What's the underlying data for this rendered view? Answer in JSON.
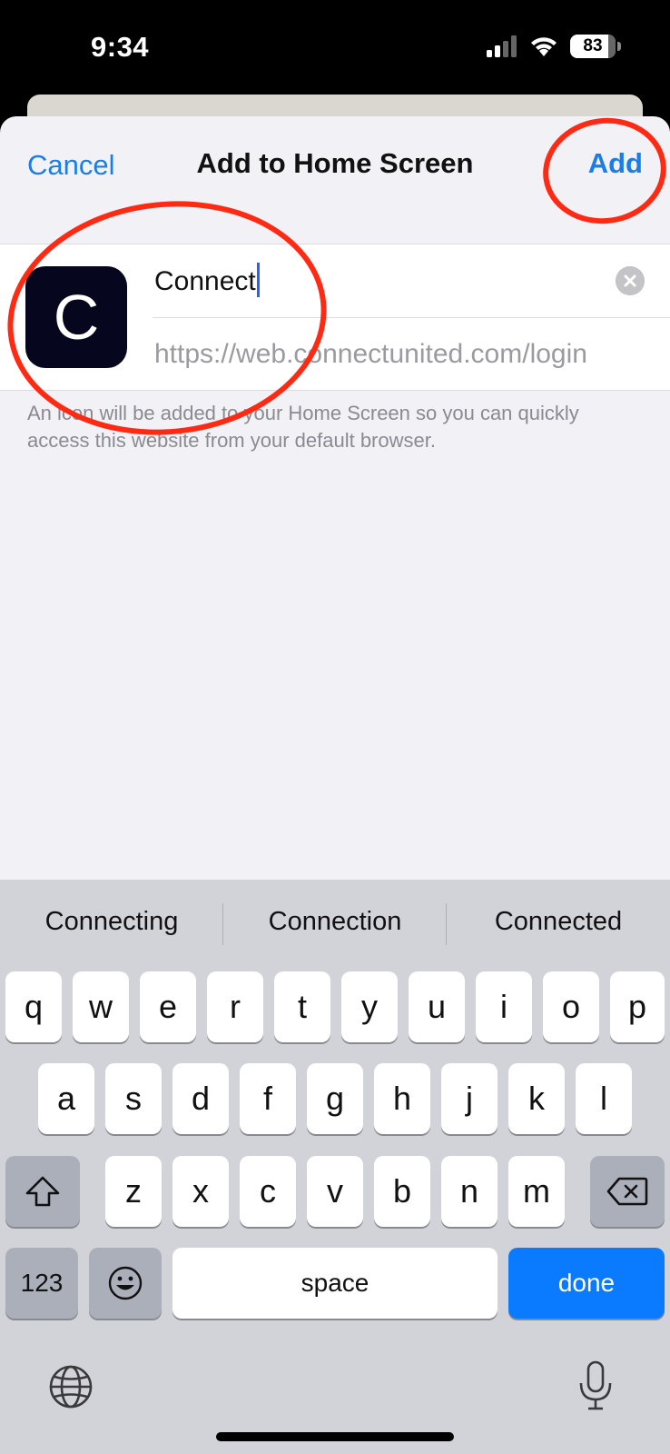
{
  "status_bar": {
    "time": "9:34",
    "battery": "83"
  },
  "sheet": {
    "cancel_label": "Cancel",
    "title": "Add to Home Screen",
    "add_label": "Add",
    "app_icon_letter": "C",
    "name_value": "Connect",
    "url": "https://web.connectunited.com/login",
    "hint": "An icon will be added to your Home Screen so you can quickly access this website from your default browser."
  },
  "keyboard": {
    "suggestions": [
      "Connecting",
      "Connection",
      "Connected"
    ],
    "row1": [
      "q",
      "w",
      "e",
      "r",
      "t",
      "y",
      "u",
      "i",
      "o",
      "p"
    ],
    "row2": [
      "a",
      "s",
      "d",
      "f",
      "g",
      "h",
      "j",
      "k",
      "l"
    ],
    "row3": [
      "z",
      "x",
      "c",
      "v",
      "b",
      "n",
      "m"
    ],
    "numbers_label": "123",
    "space_label": "space",
    "done_label": "done"
  },
  "colors": {
    "accent": "#1a7ee6",
    "annotation": "#ff2a14",
    "done_key": "#0a7bff"
  }
}
